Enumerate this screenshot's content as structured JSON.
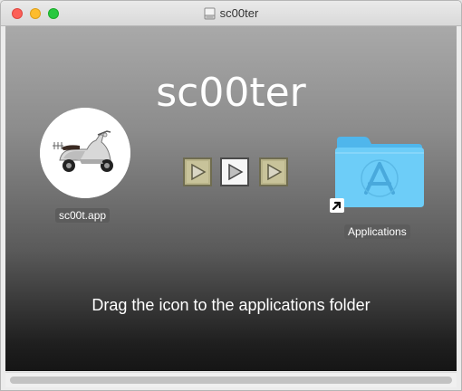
{
  "window": {
    "title": "sc00ter",
    "title_icon": "disk-image-icon"
  },
  "installer": {
    "heading": "sc00ter",
    "app_name": "sc00t.app",
    "app_icon": "scooter-app-icon",
    "folder_name": "Applications",
    "folder_icon": "applications-folder-icon",
    "instructions": "Drag the icon to the applications folder",
    "arrows": [
      "play-arrow-icon",
      "play-arrow-icon",
      "play-arrow-icon"
    ]
  },
  "colors": {
    "close": "#fc5f57",
    "minimize": "#fdbc2e",
    "maximize": "#28c840",
    "folder_blue": "#5ec4f5",
    "arrow_tan": "#b9b48a"
  }
}
